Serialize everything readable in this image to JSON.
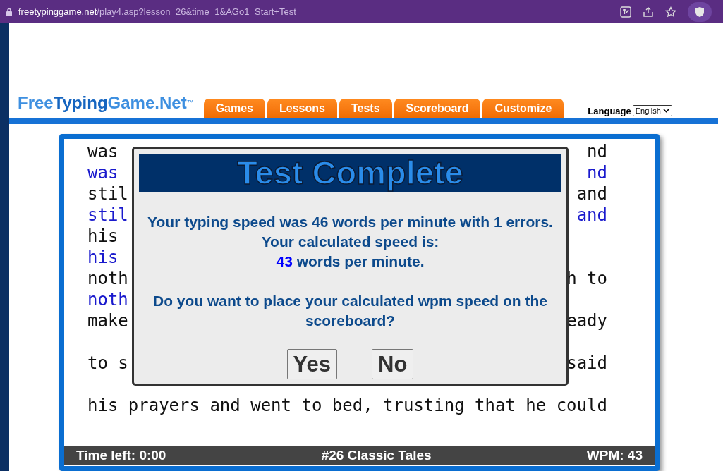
{
  "browser": {
    "url_host": "freetypinggame.net",
    "url_path": "/play4.asp?lesson=26&time=1&AGo1=Start+Test"
  },
  "header": {
    "logo": [
      {
        "text": "Free",
        "kind": "light"
      },
      {
        "text": "Typing",
        "kind": "dark"
      },
      {
        "text": "Game.Net",
        "kind": "light"
      }
    ],
    "logo_mark": "™",
    "tabs": [
      "Games",
      "Lessons",
      "Tests",
      "Scoreboard",
      "Customize"
    ],
    "language": {
      "label": "Language",
      "value": "English"
    }
  },
  "passage": [
    {
      "source": {
        "left": "was",
        "right": "nd"
      },
      "typed": {
        "left": "was",
        "right": "nd"
      }
    },
    {
      "source": {
        "left": "stil",
        "right": "and"
      },
      "typed": {
        "left": "stil",
        "right": "and"
      }
    },
    {
      "source": {
        "left": "his"
      },
      "typed": {
        "left": "his"
      }
    },
    {
      "source": {
        "left": "noth",
        "right": "h to"
      },
      "typed": {
        "left": "noth"
      }
    },
    {
      "source": {
        "left": "make",
        "right": "eady"
      }
    },
    {
      "source": {
        "left": "to s",
        "right": "said"
      }
    },
    {
      "source": {
        "left": "his prayers and went to bed, trusting that he could"
      }
    }
  ],
  "status_bar": {
    "time_left": "Time left: 0:00",
    "lesson": "#26 Classic Tales",
    "wpm": "WPM: 43"
  },
  "dialog": {
    "title": "Test Complete",
    "message_1": "Your typing speed was 46 words per minute with 1 errors. Your calculated speed is:",
    "calculated": "43",
    "message_2": "words per minute.",
    "question": "Do you want to place your calculated wpm speed on the scoreboard?",
    "buttons": [
      "Yes",
      "No"
    ]
  }
}
